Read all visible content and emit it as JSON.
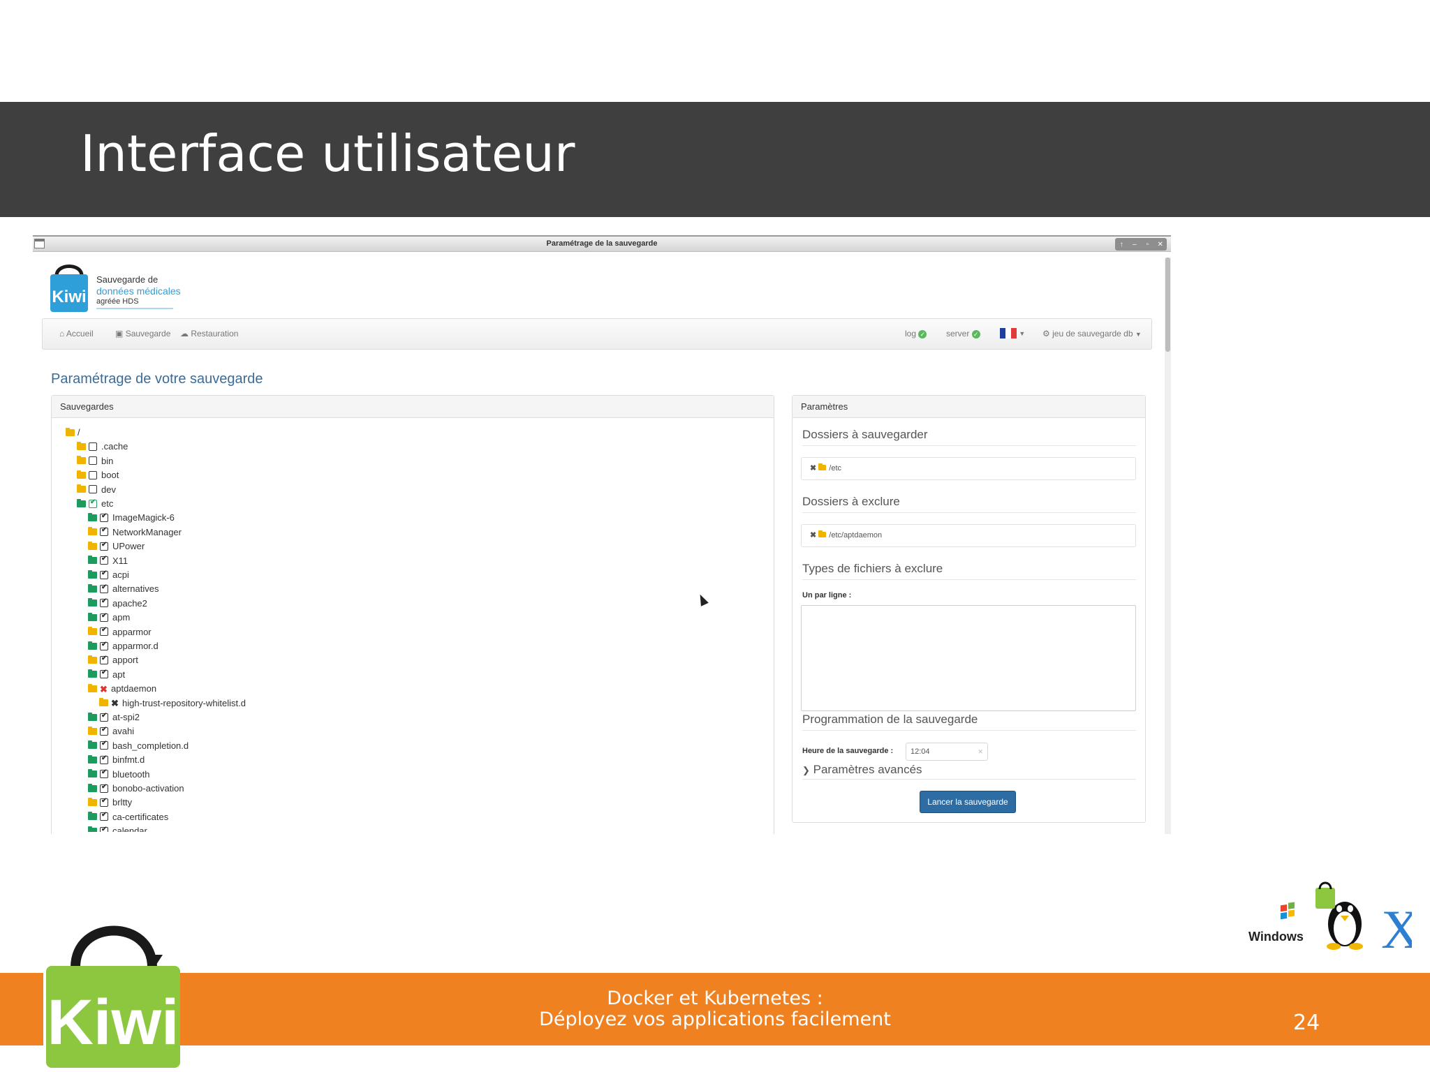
{
  "slide": {
    "title": "Interface utilisateur",
    "footer_line1": "Docker et Kubernetes :",
    "footer_line2": "Déployez vos applications facilement",
    "page_number": "24",
    "bottom_logo_text": "Kiwi",
    "os_labels": [
      "Windows"
    ]
  },
  "window": {
    "title": "Paramétrage de la sauvegarde",
    "controls": [
      "↑",
      "–",
      "▫",
      "✕"
    ]
  },
  "brand": {
    "logo_text": "Kiwi",
    "line1": "Sauvegarde de",
    "line2": "données médicales",
    "line3": "agréée HDS"
  },
  "nav": {
    "accueil": "Accueil",
    "sauvegarde": "Sauvegarde",
    "restauration": "Restauration",
    "log": "log",
    "server": "server",
    "profile": "jeu de sauvegarde db"
  },
  "page": {
    "title": "Paramétrage de votre sauvegarde"
  },
  "sauvegardes": {
    "heading": "Sauvegardes",
    "tree": [
      {
        "label": "/",
        "level": 0,
        "folder": "y",
        "open": true,
        "state": "none"
      },
      {
        "label": ".cache",
        "level": 1,
        "folder": "y",
        "state": "unchecked"
      },
      {
        "label": "bin",
        "level": 1,
        "folder": "y",
        "state": "unchecked"
      },
      {
        "label": "boot",
        "level": 1,
        "folder": "y",
        "state": "unchecked"
      },
      {
        "label": "dev",
        "level": 1,
        "folder": "y",
        "state": "unchecked"
      },
      {
        "label": "etc",
        "level": 1,
        "folder": "g",
        "open": true,
        "state": "checked-green"
      },
      {
        "label": "ImageMagick-6",
        "level": 2,
        "folder": "g",
        "state": "checked"
      },
      {
        "label": "NetworkManager",
        "level": 2,
        "folder": "y",
        "state": "checked"
      },
      {
        "label": "UPower",
        "level": 2,
        "folder": "y",
        "state": "checked"
      },
      {
        "label": "X11",
        "level": 2,
        "folder": "g",
        "state": "checked"
      },
      {
        "label": "acpi",
        "level": 2,
        "folder": "g",
        "state": "checked"
      },
      {
        "label": "alternatives",
        "level": 2,
        "folder": "g",
        "state": "checked"
      },
      {
        "label": "apache2",
        "level": 2,
        "folder": "g",
        "state": "checked"
      },
      {
        "label": "apm",
        "level": 2,
        "folder": "g",
        "state": "checked"
      },
      {
        "label": "apparmor",
        "level": 2,
        "folder": "y",
        "state": "checked"
      },
      {
        "label": "apparmor.d",
        "level": 2,
        "folder": "g",
        "state": "checked"
      },
      {
        "label": "apport",
        "level": 2,
        "folder": "y",
        "state": "checked"
      },
      {
        "label": "apt",
        "level": 2,
        "folder": "g",
        "state": "checked"
      },
      {
        "label": "aptdaemon",
        "level": 2,
        "folder": "y",
        "open": true,
        "state": "excluded"
      },
      {
        "label": "high-trust-repository-whitelist.d",
        "level": 3,
        "folder": "y",
        "state": "excluded-black"
      },
      {
        "label": "at-spi2",
        "level": 2,
        "folder": "g",
        "state": "checked"
      },
      {
        "label": "avahi",
        "level": 2,
        "folder": "y",
        "state": "checked"
      },
      {
        "label": "bash_completion.d",
        "level": 2,
        "folder": "g",
        "state": "checked"
      },
      {
        "label": "binfmt.d",
        "level": 2,
        "folder": "g",
        "state": "checked"
      },
      {
        "label": "bluetooth",
        "level": 2,
        "folder": "g",
        "state": "checked"
      },
      {
        "label": "bonobo-activation",
        "level": 2,
        "folder": "g",
        "state": "checked"
      },
      {
        "label": "brltty",
        "level": 2,
        "folder": "y",
        "state": "checked"
      },
      {
        "label": "ca-certificates",
        "level": 2,
        "folder": "g",
        "state": "checked"
      },
      {
        "label": "calendar",
        "level": 2,
        "folder": "g",
        "state": "checked"
      }
    ]
  },
  "parametres": {
    "heading": "Paramètres",
    "include_title": "Dossiers à sauvegarder",
    "include_items": [
      "/etc"
    ],
    "exclude_title": "Dossiers à exclure",
    "exclude_items": [
      "/etc/aptdaemon"
    ],
    "types_title": "Types de fichiers à exclure",
    "types_label": "Un par ligne :",
    "types_value": "",
    "schedule_title": "Programmation de la sauvegarde",
    "time_label": "Heure de la sauvegarde :",
    "time_value": "12:04",
    "advanced_label": "Paramètres avancés",
    "launch_button": "Lancer la sauvegarde"
  },
  "colors": {
    "header_bg": "#3f3f3f",
    "footer_bg": "#ef8121",
    "accent_blue": "#3b6c98",
    "button_blue": "#2e6da4",
    "folder_yellow": "#f0b400",
    "folder_green": "#1d9b5f",
    "kiwi_green": "#8dc63f"
  }
}
